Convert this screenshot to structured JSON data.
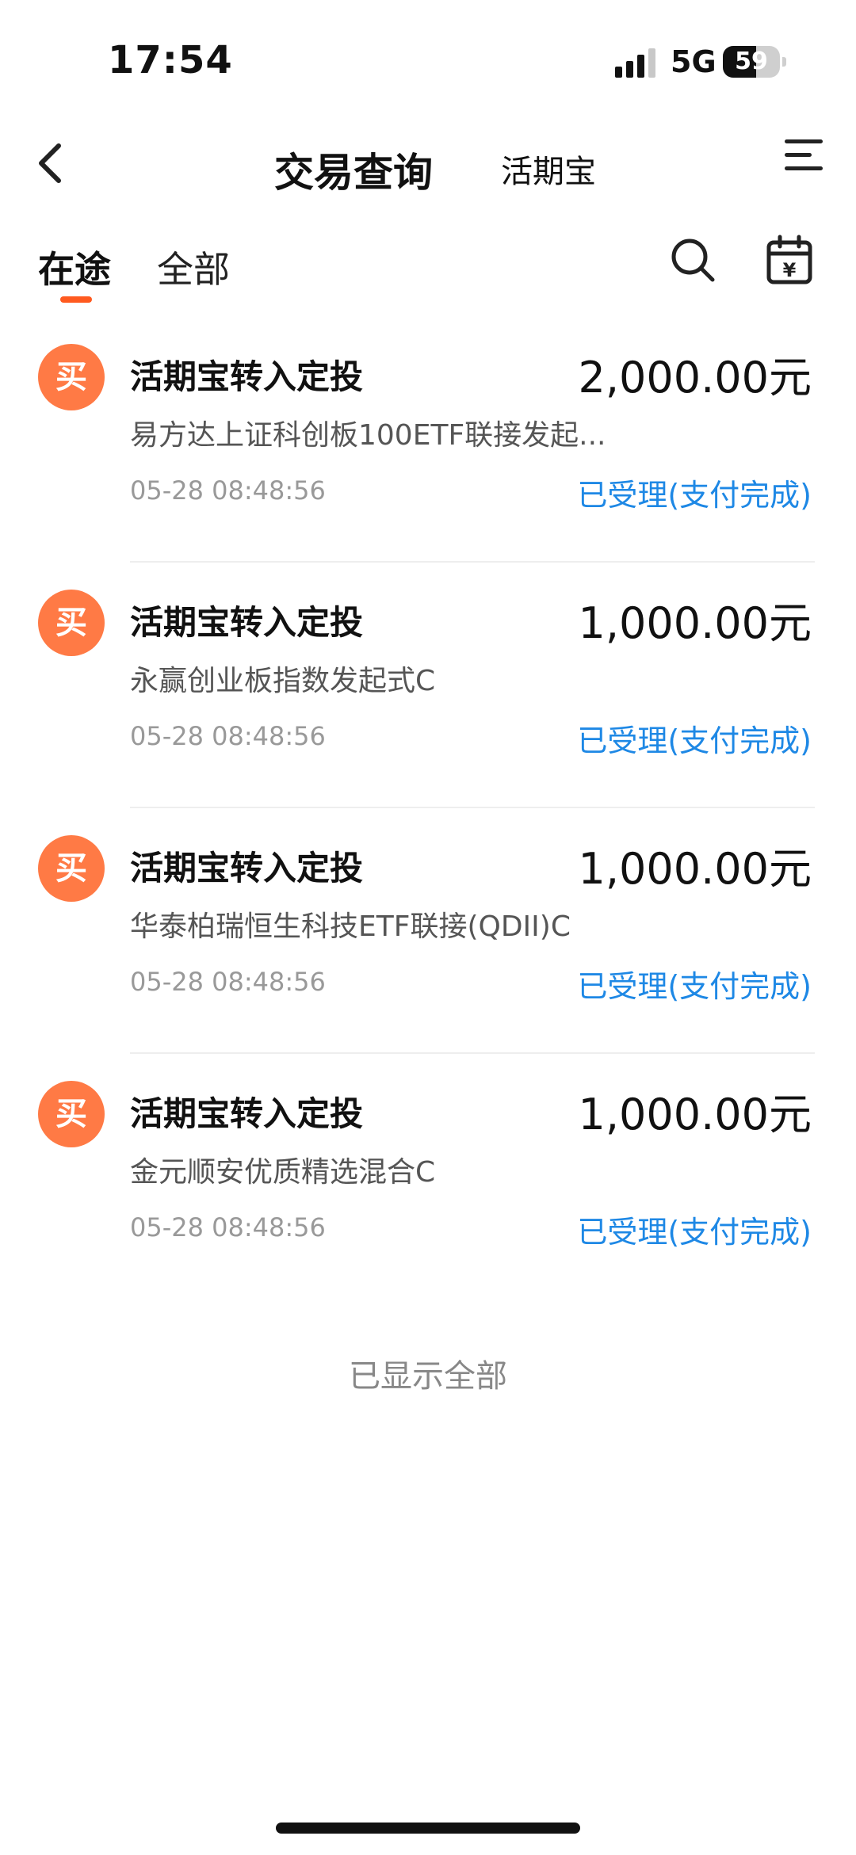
{
  "status_bar": {
    "time": "17:54",
    "network": "5G",
    "battery_level": "59",
    "battery_fill_percent": 59
  },
  "nav": {
    "title": "交易查询",
    "subtitle": "活期宝"
  },
  "tabs": [
    {
      "label": "在途",
      "active": true
    },
    {
      "label": "全部",
      "active": false
    }
  ],
  "transactions": [
    {
      "badge": "买",
      "type": "活期宝转入定投",
      "amount": "2,000.00元",
      "fund": "易方达上证科创板100ETF联接发起...",
      "time": "05-28 08:48:56",
      "status": "已受理(支付完成)"
    },
    {
      "badge": "买",
      "type": "活期宝转入定投",
      "amount": "1,000.00元",
      "fund": "永赢创业板指数发起式C",
      "time": "05-28 08:48:56",
      "status": "已受理(支付完成)"
    },
    {
      "badge": "买",
      "type": "活期宝转入定投",
      "amount": "1,000.00元",
      "fund": "华泰柏瑞恒生科技ETF联接(QDII)C",
      "time": "05-28 08:48:56",
      "status": "已受理(支付完成)"
    },
    {
      "badge": "买",
      "type": "活期宝转入定投",
      "amount": "1,000.00元",
      "fund": "金元顺安优质精选混合C",
      "time": "05-28 08:48:56",
      "status": "已受理(支付完成)"
    }
  ],
  "footer": {
    "note": "已显示全部"
  },
  "colors": {
    "accent": "#ff5a1f",
    "badge": "#ff7a45",
    "status_link": "#1e88e5"
  }
}
